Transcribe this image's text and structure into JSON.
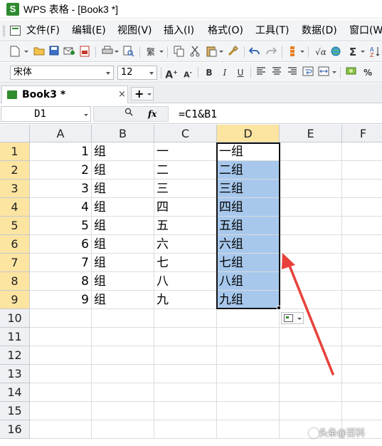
{
  "window": {
    "logo_letter": "S",
    "title": "WPS 表格 - [Book3 *]"
  },
  "menu": {
    "items": [
      "文件(F)",
      "编辑(E)",
      "视图(V)",
      "插入(I)",
      "格式(O)",
      "工具(T)",
      "数据(D)",
      "窗口(W"
    ]
  },
  "toolbar1": {
    "icons": [
      "new-icon",
      "open-icon",
      "save-icon",
      "email-icon",
      "pdf-icon",
      "print-icon",
      "print-preview-icon",
      "traditional-chinese-icon",
      "copy-icon",
      "cut-icon",
      "paste-icon",
      "format-painter-icon",
      "undo-icon",
      "redo-icon",
      "row-col-icon",
      "insert-function-icon",
      "web-icon",
      "autosum-icon",
      "sort-icon"
    ],
    "glyphs": {
      "traditional": "繁",
      "sum": "Σ",
      "sqrt": "√α"
    }
  },
  "toolbar2": {
    "font_name": "宋体",
    "font_size": "12",
    "grow_font": "A",
    "shrink_font": "A",
    "bold": "B",
    "italic": "I",
    "underline": "U",
    "percent": "%"
  },
  "tabs": {
    "active": "Book3 *",
    "close": "×",
    "new_tab": "+"
  },
  "formula_bar": {
    "name_box": "D1",
    "fx": "fx",
    "formula": "=C1&B1"
  },
  "grid": {
    "columns": [
      "A",
      "B",
      "C",
      "D",
      "E",
      "F"
    ],
    "active_column": "D",
    "rows": [
      "1",
      "2",
      "3",
      "4",
      "5",
      "6",
      "7",
      "8",
      "9",
      "10",
      "11",
      "12",
      "13",
      "14",
      "15",
      "16"
    ],
    "data": [
      {
        "a": "1",
        "b": "组",
        "c": "一",
        "d": "一组"
      },
      {
        "a": "2",
        "b": "组",
        "c": "二",
        "d": "二组"
      },
      {
        "a": "3",
        "b": "组",
        "c": "三",
        "d": "三组"
      },
      {
        "a": "4",
        "b": "组",
        "c": "四",
        "d": "四组"
      },
      {
        "a": "5",
        "b": "组",
        "c": "五",
        "d": "五组"
      },
      {
        "a": "6",
        "b": "组",
        "c": "六",
        "d": "六组"
      },
      {
        "a": "7",
        "b": "组",
        "c": "七",
        "d": "七组"
      },
      {
        "a": "8",
        "b": "组",
        "c": "八",
        "d": "八组"
      },
      {
        "a": "9",
        "b": "组",
        "c": "九",
        "d": "九组"
      }
    ],
    "selection_color": "#a7c8ec",
    "header_highlight": "#fce4a1"
  },
  "annotation": {
    "arrow_color": "#e8413b"
  },
  "watermark": {
    "text": "头条@百科"
  }
}
